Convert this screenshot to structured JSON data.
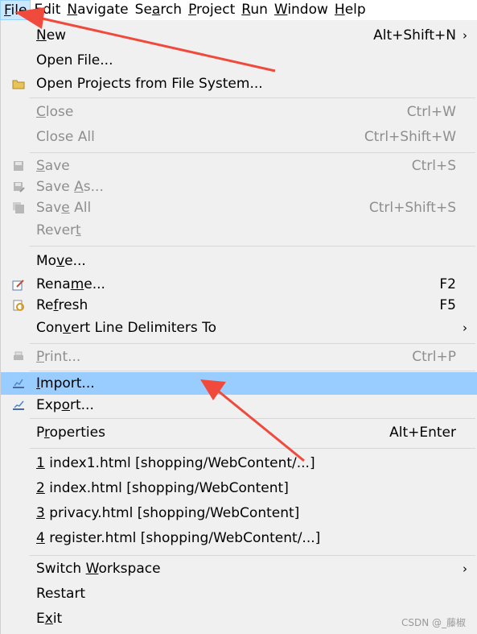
{
  "menubar": [
    {
      "key": "file",
      "prefix": "",
      "mnemonic": "F",
      "suffix": "ile",
      "active": true
    },
    {
      "key": "edit",
      "prefix": "",
      "mnemonic": "E",
      "suffix": "dit"
    },
    {
      "key": "navigate",
      "prefix": "",
      "mnemonic": "N",
      "suffix": "avigate"
    },
    {
      "key": "search",
      "prefix": "Se",
      "mnemonic": "a",
      "suffix": "rch"
    },
    {
      "key": "project",
      "prefix": "",
      "mnemonic": "P",
      "suffix": "roject"
    },
    {
      "key": "run",
      "prefix": "",
      "mnemonic": "R",
      "suffix": "un"
    },
    {
      "key": "window",
      "prefix": "",
      "mnemonic": "W",
      "suffix": "indow"
    },
    {
      "key": "help",
      "prefix": "",
      "mnemonic": "H",
      "suffix": "elp"
    }
  ],
  "file_menu": [
    {
      "key": "new",
      "prefix": "",
      "mnemonic": "N",
      "suffix": "ew",
      "shortcut": "Alt+Shift+N",
      "submenu": true
    },
    {
      "key": "open-file",
      "prefix": "Open File...",
      "mnemonic": "",
      "suffix": ""
    },
    {
      "key": "open-projects",
      "prefix": "Open Projects from File System...",
      "mnemonic": "",
      "suffix": "",
      "icon": "folder-icon"
    },
    {
      "key": "close",
      "prefix": "",
      "mnemonic": "C",
      "suffix": "lose",
      "shortcut": "Ctrl+W",
      "disabled": true
    },
    {
      "key": "close-all",
      "prefix": "Close All",
      "mnemonic": "",
      "suffix": "",
      "shortcut": "Ctrl+Shift+W",
      "disabled": true
    },
    {
      "key": "save",
      "prefix": "",
      "mnemonic": "S",
      "suffix": "ave",
      "shortcut": "Ctrl+S",
      "disabled": true,
      "icon": "save-icon"
    },
    {
      "key": "save-as",
      "prefix": "Save ",
      "mnemonic": "A",
      "suffix": "s...",
      "disabled": true,
      "icon": "save-as-icon"
    },
    {
      "key": "save-all",
      "prefix": "Sav",
      "mnemonic": "e",
      "suffix": " All",
      "shortcut": "Ctrl+Shift+S",
      "disabled": true,
      "icon": "save-all-icon"
    },
    {
      "key": "revert",
      "prefix": "Rever",
      "mnemonic": "t",
      "suffix": "",
      "disabled": true
    },
    {
      "key": "move",
      "prefix": "Mo",
      "mnemonic": "v",
      "suffix": "e..."
    },
    {
      "key": "rename",
      "prefix": "Rena",
      "mnemonic": "m",
      "suffix": "e...",
      "shortcut": "F2",
      "icon": "rename-icon"
    },
    {
      "key": "refresh",
      "prefix": "Re",
      "mnemonic": "f",
      "suffix": "resh",
      "shortcut": "F5",
      "icon": "refresh-icon"
    },
    {
      "key": "convert",
      "prefix": "Con",
      "mnemonic": "v",
      "suffix": "ert Line Delimiters To",
      "submenu": true
    },
    {
      "key": "print",
      "prefix": "",
      "mnemonic": "P",
      "suffix": "rint...",
      "shortcut": "Ctrl+P",
      "disabled": true,
      "icon": "print-icon"
    },
    {
      "key": "import",
      "prefix": "",
      "mnemonic": "I",
      "suffix": "mport...",
      "icon": "import-icon",
      "selected": true
    },
    {
      "key": "export",
      "prefix": "Exp",
      "mnemonic": "o",
      "suffix": "rt...",
      "icon": "export-icon"
    },
    {
      "key": "properties",
      "prefix": "P",
      "mnemonic": "r",
      "suffix": "operties",
      "shortcut": "Alt+Enter"
    },
    {
      "key": "recent-1",
      "prefix": "",
      "mnemonic": "1",
      "suffix": " index1.html  [shopping/WebContent/...]"
    },
    {
      "key": "recent-2",
      "prefix": "",
      "mnemonic": "2",
      "suffix": " index.html  [shopping/WebContent]"
    },
    {
      "key": "recent-3",
      "prefix": "",
      "mnemonic": "3",
      "suffix": " privacy.html  [shopping/WebContent]"
    },
    {
      "key": "recent-4",
      "prefix": "",
      "mnemonic": "4",
      "suffix": " register.html  [shopping/WebContent/...]"
    },
    {
      "key": "switch-workspace",
      "prefix": "Switch ",
      "mnemonic": "W",
      "suffix": "orkspace",
      "submenu": true
    },
    {
      "key": "restart",
      "prefix": "Restart",
      "mnemonic": "",
      "suffix": ""
    },
    {
      "key": "exit",
      "prefix": "E",
      "mnemonic": "x",
      "suffix": "it"
    }
  ],
  "submenu_glyph": "›",
  "watermark": "CSDN @_藤椒",
  "colors": {
    "selection": "#99ccff",
    "disabled": "#8e8e8e",
    "arrow": "#f04a3c",
    "menubar_active": "#cce8ff"
  }
}
